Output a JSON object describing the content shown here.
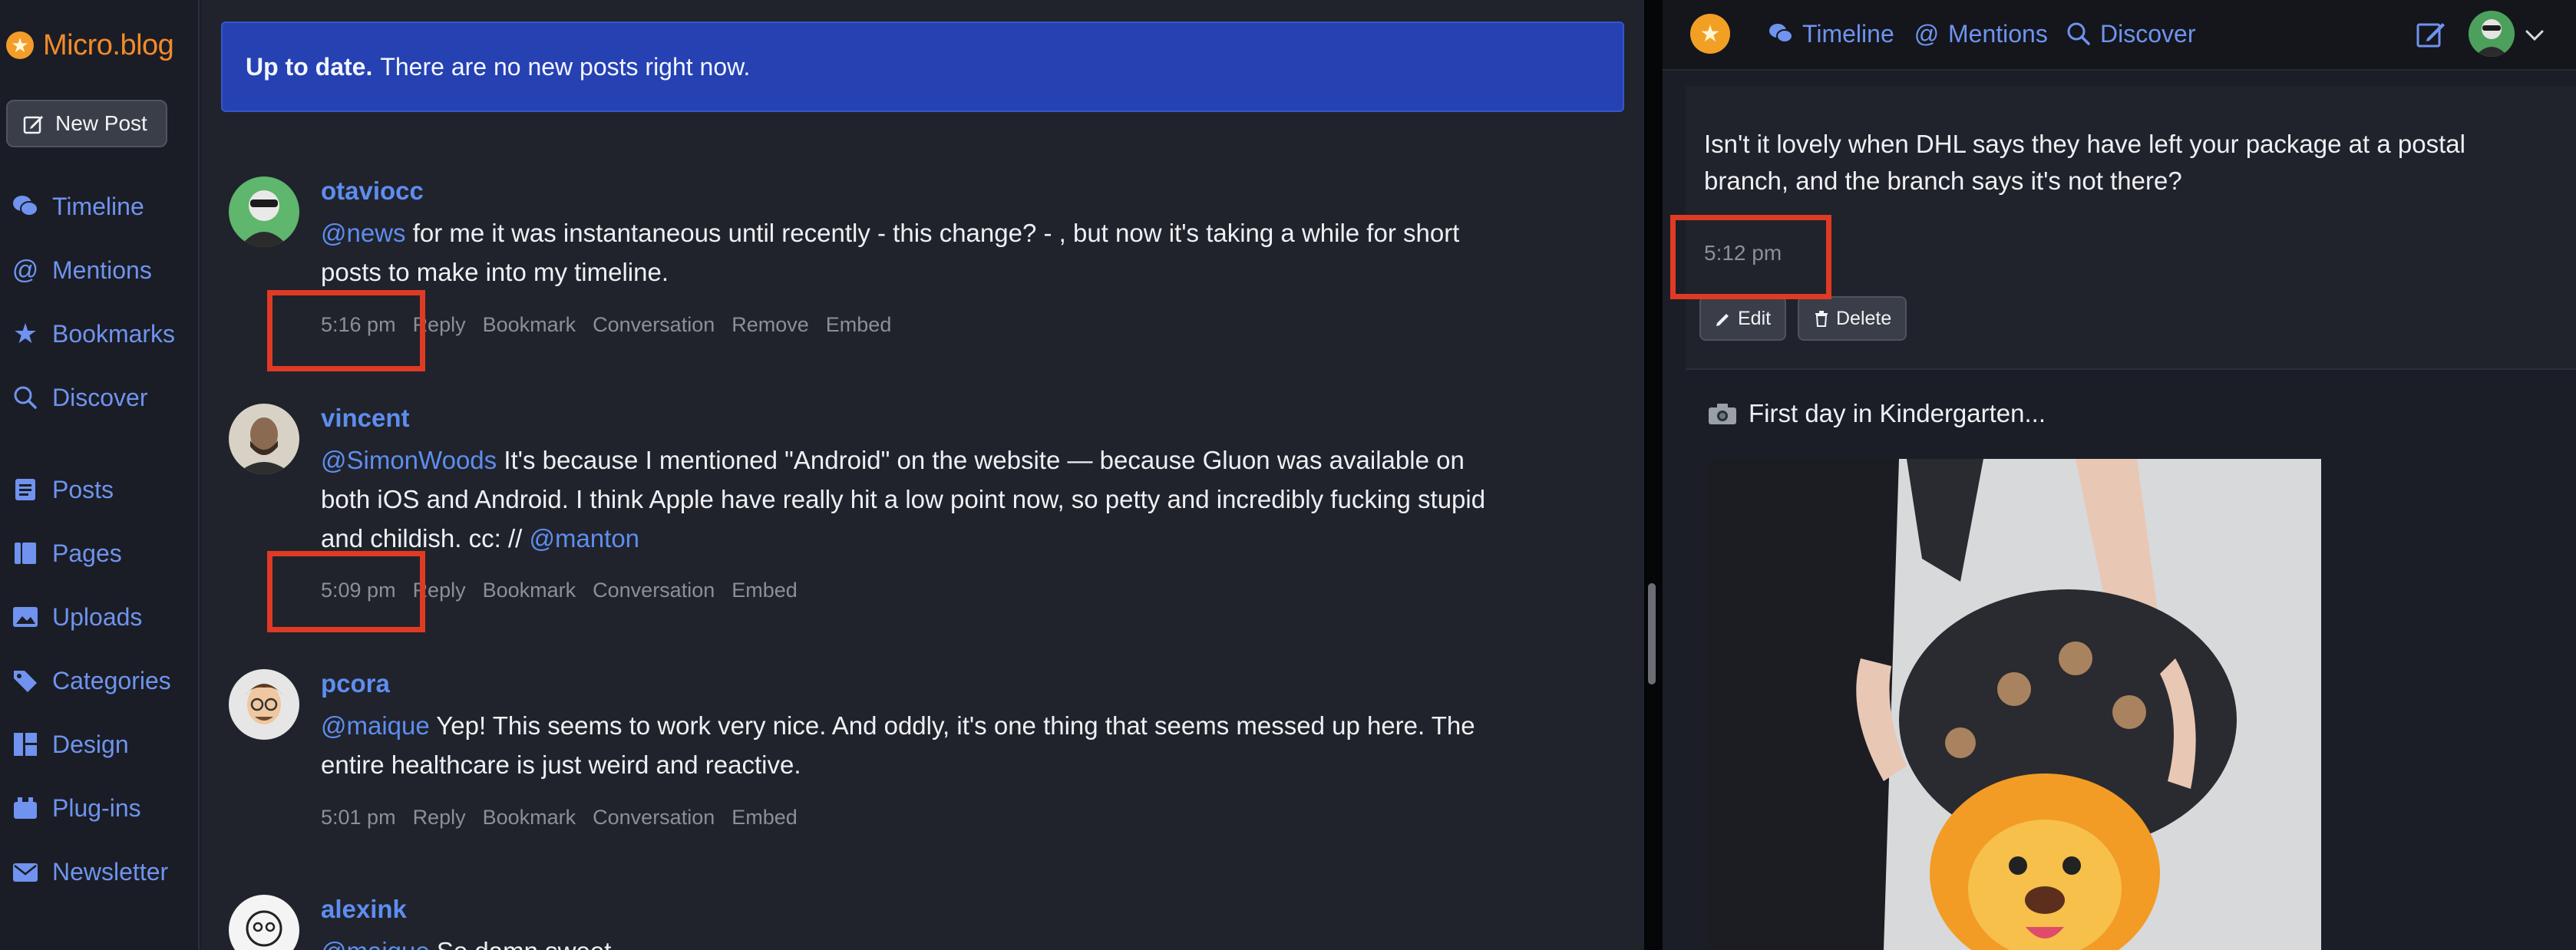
{
  "app": {
    "brand": "Micro.blog",
    "new_post_label": "New Post"
  },
  "sidebar": {
    "items": [
      {
        "label": "Timeline",
        "icon": "chat-bubbles-icon"
      },
      {
        "label": "Mentions",
        "icon": "at-icon"
      },
      {
        "label": "Bookmarks",
        "icon": "star-icon"
      },
      {
        "label": "Discover",
        "icon": "search-icon"
      },
      {
        "label": "Posts",
        "icon": "document-icon"
      },
      {
        "label": "Pages",
        "icon": "pages-icon"
      },
      {
        "label": "Uploads",
        "icon": "image-icon"
      },
      {
        "label": "Categories",
        "icon": "tag-icon"
      },
      {
        "label": "Design",
        "icon": "layout-icon"
      },
      {
        "label": "Plug-ins",
        "icon": "plugin-icon"
      },
      {
        "label": "Newsletter",
        "icon": "mail-icon"
      }
    ]
  },
  "banner": {
    "bold": "Up to date.",
    "text": "There are no new posts right now."
  },
  "posts": [
    {
      "user": "otaviocc",
      "mention": "@news",
      "text": " for me it was instantaneous until recently - this change? - , but now it's taking a while for short posts to make into my timeline.",
      "time": "5:16 pm",
      "actions": [
        "Reply",
        "Bookmark",
        "Conversation",
        "Remove",
        "Embed"
      ]
    },
    {
      "user": "vincent",
      "mention": "@SimonWoods",
      "text": " It's because I mentioned \"Android\" on the website — because Gluon was available on both iOS and Android. I think Apple have really hit a low point now, so petty and incredibly fucking stupid and childish. cc: // ",
      "mention2": "@manton",
      "time": "5:09 pm",
      "actions": [
        "Reply",
        "Bookmark",
        "Conversation",
        "Embed"
      ]
    },
    {
      "user": "pcora",
      "mention": "@maique",
      "text": " Yep! This seems to work very nice. And oddly, it's one thing that seems messed up here. The entire healthcare is just weird and reactive.",
      "time": "5:01 pm",
      "actions": [
        "Reply",
        "Bookmark",
        "Conversation",
        "Embed"
      ]
    },
    {
      "user": "alexink",
      "mention": "@maique",
      "text": " So damn sweet",
      "time": "",
      "actions": []
    }
  ],
  "right": {
    "nav": [
      {
        "label": "Timeline",
        "icon": "chat-bubbles-icon"
      },
      {
        "label": "Mentions",
        "icon": "at-icon"
      },
      {
        "label": "Discover",
        "icon": "search-icon"
      }
    ],
    "my_post": {
      "text": "Isn't it lovely when DHL says they have left your package at a postal branch, and the branch says it's not there?",
      "time": "5:12 pm",
      "edit_label": "Edit",
      "delete_label": "Delete"
    },
    "post2": {
      "text": "First day in Kindergarten..."
    }
  },
  "colors": {
    "accent": "#5e8df0",
    "brand": "#f38a2a",
    "banner": "#2541b2",
    "highlight": "#e03a24"
  }
}
